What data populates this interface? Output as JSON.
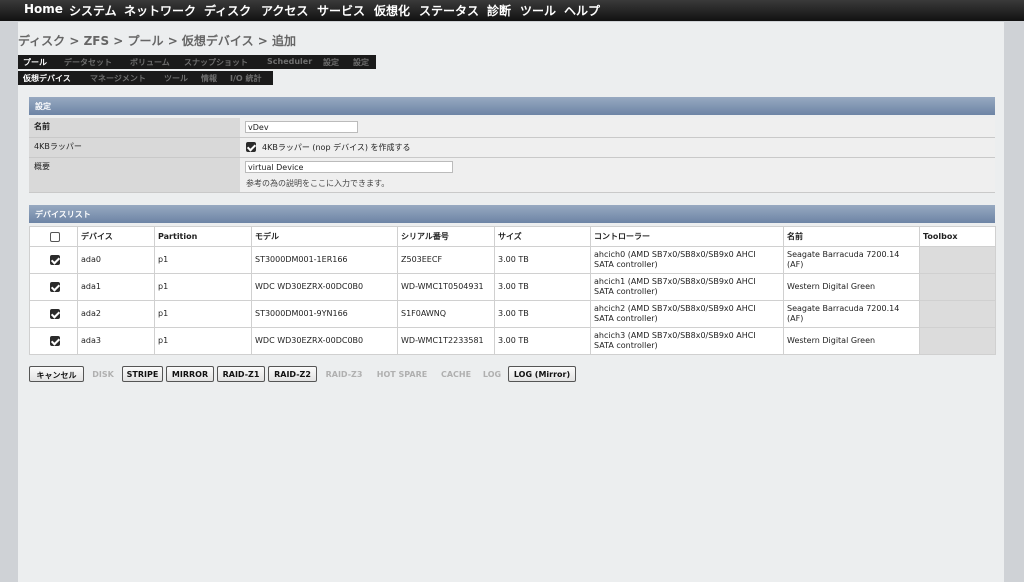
{
  "topnav": {
    "items": [
      "Home",
      "システム",
      "ネットワーク",
      "ディスク",
      "アクセス",
      "サービス",
      "仮想化",
      "ステータス",
      "診断",
      "ツール",
      "ヘルプ"
    ]
  },
  "breadcrumb": "ディスク > ZFS > プール > 仮想デバイス > 追加",
  "tabs_primary": [
    "プール",
    "データセット",
    "ボリューム",
    "スナップショット",
    "Scheduler",
    "設定",
    "設定"
  ],
  "tabs_secondary": [
    "仮想デバイス",
    "マネージメント",
    "ツール",
    "情報",
    "I/O 統計"
  ],
  "settings": {
    "title": "設定",
    "name_label": "名前",
    "name_value": "vDev",
    "wrapper_label": "4KBラッパー",
    "wrapper_text": "4KBラッパー (nop デバイス) を作成する",
    "wrapper_checked": true,
    "desc_label": "概要",
    "desc_value": "virtual Device",
    "desc_hint": "参考の為の説明をここに入力できます。"
  },
  "device_list": {
    "title": "デバイスリスト",
    "headers": [
      "デバイス",
      "Partition",
      "モデル",
      "シリアル番号",
      "サイズ",
      "コントローラー",
      "名前",
      "Toolbox"
    ],
    "header_checked": false,
    "rows": [
      {
        "checked": true,
        "device": "ada0",
        "partition": "p1",
        "model": "ST3000DM001-1ER166",
        "serial": "Z503EECF",
        "size": "3.00 TB",
        "controller_1": "ahcich0 (AMD SB7x0/SB8x0/SB9x0 AHCI",
        "controller_2": "SATA controller)",
        "name_1": "Seagate Barracuda 7200.14",
        "name_2": "(AF)"
      },
      {
        "checked": true,
        "device": "ada1",
        "partition": "p1",
        "model": "WDC WD30EZRX-00DC0B0",
        "serial": "WD-WMC1T0504931",
        "size": "3.00 TB",
        "controller_1": "ahcich1 (AMD SB7x0/SB8x0/SB9x0 AHCI",
        "controller_2": "SATA controller)",
        "name_1": "Western Digital Green",
        "name_2": ""
      },
      {
        "checked": true,
        "device": "ada2",
        "partition": "p1",
        "model": "ST3000DM001-9YN166",
        "serial": "S1F0AWNQ",
        "size": "3.00 TB",
        "controller_1": "ahcich2 (AMD SB7x0/SB8x0/SB9x0 AHCI",
        "controller_2": "SATA controller)",
        "name_1": "Seagate Barracuda 7200.14",
        "name_2": "(AF)"
      },
      {
        "checked": true,
        "device": "ada3",
        "partition": "p1",
        "model": "WDC WD30EZRX-00DC0B0",
        "serial": "WD-WMC1T2233581",
        "size": "3.00 TB",
        "controller_1": "ahcich3 (AMD SB7x0/SB8x0/SB9x0 AHCI",
        "controller_2": "SATA controller)",
        "name_1": "Western Digital Green",
        "name_2": ""
      }
    ]
  },
  "buttons": [
    {
      "label": "キャンセル",
      "enabled": true
    },
    {
      "label": "DISK",
      "enabled": false
    },
    {
      "label": "STRIPE",
      "enabled": true
    },
    {
      "label": "MIRROR",
      "enabled": true
    },
    {
      "label": "RAID-Z1",
      "enabled": true
    },
    {
      "label": "RAID-Z2",
      "enabled": true
    },
    {
      "label": "RAID-Z3",
      "enabled": false
    },
    {
      "label": "HOT SPARE",
      "enabled": false
    },
    {
      "label": "CACHE",
      "enabled": false
    },
    {
      "label": "LOG",
      "enabled": false
    },
    {
      "label": "LOG (Mirror)",
      "enabled": true
    }
  ],
  "colors": {
    "nav_bg": "#1a1a1a",
    "panel_header": "#7d92b0",
    "page_bg": "#eceeef"
  }
}
